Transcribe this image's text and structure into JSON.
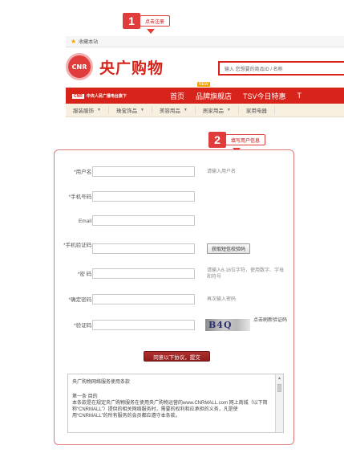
{
  "callouts": [
    {
      "number": "1",
      "text": "点击注册"
    },
    {
      "number": "2",
      "text": "填写用户信息"
    }
  ],
  "topbar": {
    "favorite_label": "收藏本站"
  },
  "logo": {
    "badge": "CNR",
    "name": "央广购物"
  },
  "search": {
    "placeholder": "输入 您想要的商品ID / 名称"
  },
  "navbar": {
    "brand_badge": "CNR",
    "brand_text": "中央人民广播电台旗下",
    "items": [
      {
        "label": "首页"
      },
      {
        "label": "品牌旗舰店",
        "badge": "NEW"
      },
      {
        "label": "TSV今日特惠"
      },
      {
        "label": "T"
      }
    ]
  },
  "categories": [
    {
      "label": "服装服饰"
    },
    {
      "label": "珠宝饰品"
    },
    {
      "label": "美容用品"
    },
    {
      "label": "居家用品"
    },
    {
      "label": "家用电器"
    }
  ],
  "form": {
    "username_label": "*用户名:",
    "username_hint": "请输入用户名",
    "phone_label": "*手机号码:",
    "email_label": "Email:",
    "sms_label": "*手机验证码:",
    "sms_button": "获取短信校验码",
    "password_label": "*密 码:",
    "password_hint": "请输入6-16位字符，使用数字、字母和符号",
    "confirm_label": "*确定密码:",
    "confirm_hint": "再次输入密码",
    "captcha_label": "*验证码:",
    "captcha_text": "B4Q",
    "refresh_text": "点击刷新验证码",
    "submit_button": "同意以下协议，提交"
  },
  "terms": {
    "title": "央广购物网络服务使用条款",
    "section": "第一条 目的",
    "body": "本条款是在规定央广购物服务在使用央广购物运营的www.CNRMALL.com 网上商城（以下简称“CNRMALL”）提供的相关网络服务时，需要的权利和应承担的义务，凡是使用“CNRMALL”的所有服务的会员都应遵守本条款。"
  },
  "colors": {
    "brand_red": "#d7231a",
    "callout_red": "#e03c3c",
    "submit_red": "#9e2424"
  }
}
